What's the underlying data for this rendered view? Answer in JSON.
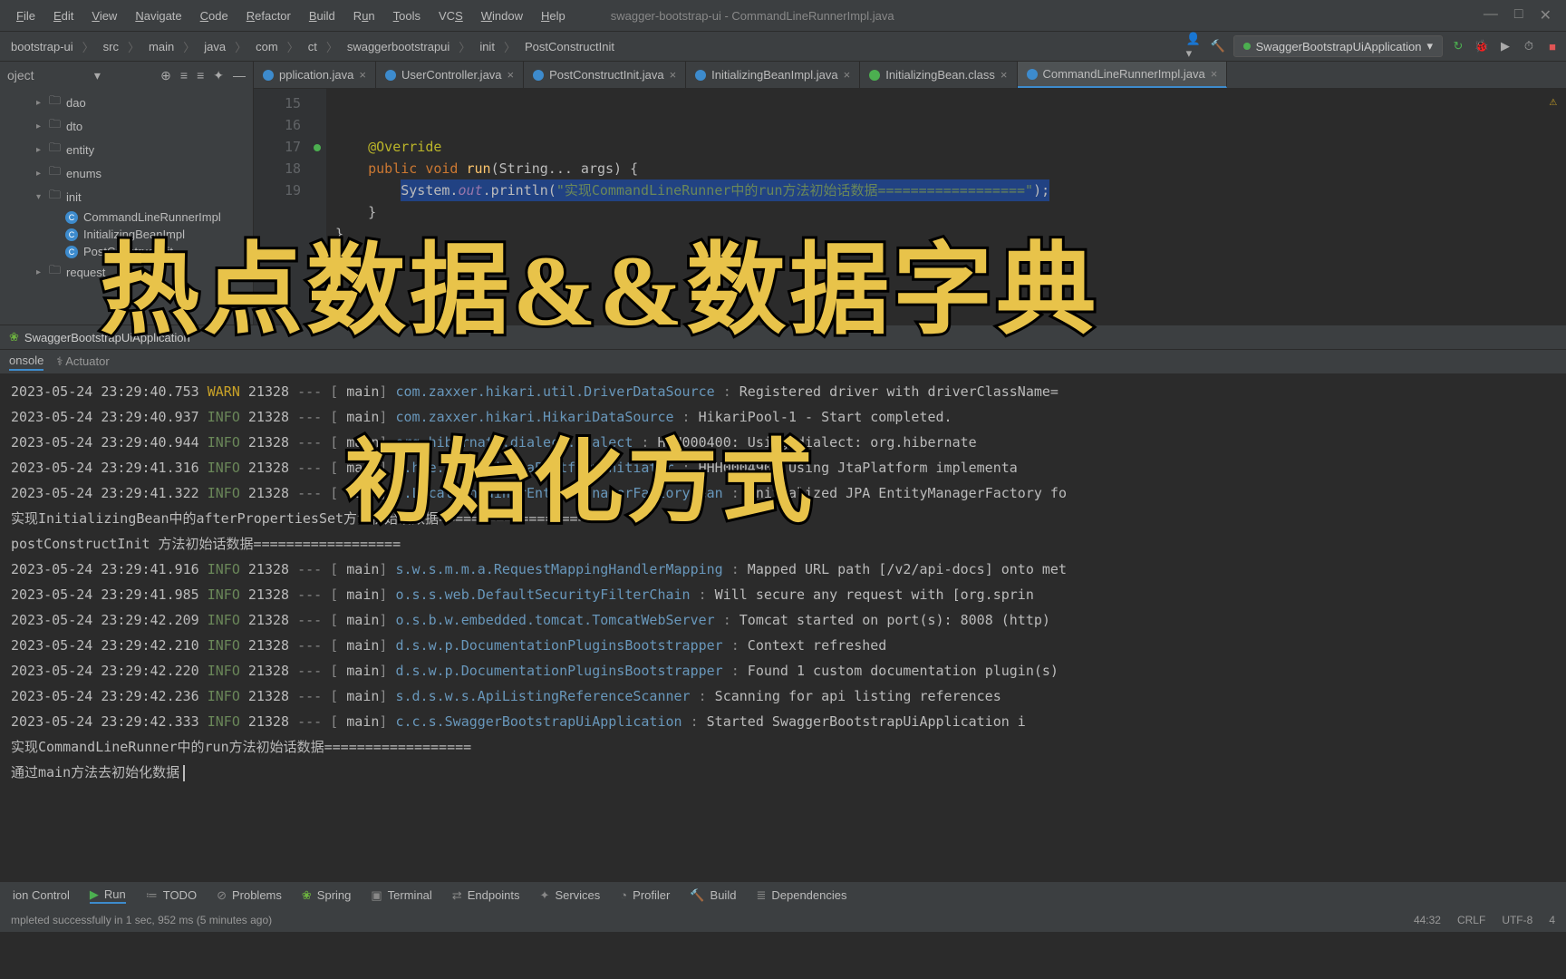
{
  "window_title": "swagger-bootstrap-ui - CommandLineRunnerImpl.java",
  "menu": [
    "File",
    "Edit",
    "View",
    "Navigate",
    "Code",
    "Refactor",
    "Build",
    "Run",
    "Tools",
    "VCS",
    "Window",
    "Help"
  ],
  "breadcrumb": [
    "bootstrap-ui",
    "src",
    "main",
    "java",
    "com",
    "ct",
    "swaggerbootstrapui",
    "init",
    "PostConstructInit"
  ],
  "run_config": "SwaggerBootstrapUiApplication",
  "project_label": "oject",
  "tree": {
    "items": [
      {
        "kind": "folder",
        "name": "dao",
        "indent": 1,
        "expand": "right"
      },
      {
        "kind": "folder",
        "name": "dto",
        "indent": 1,
        "expand": "right"
      },
      {
        "kind": "folder",
        "name": "entity",
        "indent": 1,
        "expand": "right"
      },
      {
        "kind": "folder",
        "name": "enums",
        "indent": 1,
        "expand": "right"
      },
      {
        "kind": "folder",
        "name": "init",
        "indent": 1,
        "expand": "down"
      },
      {
        "kind": "class",
        "name": "CommandLineRunnerImpl",
        "indent": 2
      },
      {
        "kind": "class",
        "name": "InitializingBeanImpl",
        "indent": 2
      },
      {
        "kind": "class",
        "name": "PostConstructInit",
        "indent": 2
      },
      {
        "kind": "folder",
        "name": "request",
        "indent": 1,
        "expand": "right"
      }
    ]
  },
  "swagger_run_label": "SwaggerBootstrapUiApplication",
  "editor_tabs": [
    {
      "label": "pplication.java"
    },
    {
      "label": "UserController.java"
    },
    {
      "label": "PostConstructInit.java"
    },
    {
      "label": "InitializingBeanImpl.java"
    },
    {
      "label": "InitializingBean.class",
      "green": true
    },
    {
      "label": "CommandLineRunnerImpl.java",
      "active": true
    }
  ],
  "code": {
    "gutter": [
      "15",
      "16",
      "17",
      "18",
      "19",
      ""
    ],
    "l16_ann": "@Override",
    "l17_kw1": "public void ",
    "l17_fn": "run",
    "l17_rest": "(String... args) {",
    "l18_pre": "System.",
    "l18_fld": "out",
    "l18_call": ".println(",
    "l18_str": "\"实现CommandLineRunner中的run方法初始话数据==================\"",
    "l18_end": ");",
    "l19": "    }",
    "l20": "}"
  },
  "run_subtabs": {
    "console": "onsole",
    "actuator": "Actuator"
  },
  "logs": [
    {
      "ts": "2023-05-24 23:29:40.753",
      "lvl": "WARN",
      "pid": "21328",
      "thread": "main",
      "logger": "com.zaxxer.hikari.util.DriverDataSource",
      "msg": "Registered driver with driverClassName="
    },
    {
      "ts": "2023-05-24 23:29:40.937",
      "lvl": "INFO",
      "pid": "21328",
      "thread": "main",
      "logger": "com.zaxxer.hikari.HikariDataSource",
      "msg": "HikariPool-1 - Start completed."
    },
    {
      "ts": "2023-05-24 23:29:40.944",
      "lvl": "INFO",
      "pid": "21328",
      "thread": "main",
      "logger": "org.hibernate.dialect.Dialect",
      "msg": "HHH000400: Using dialect: org.hibernate"
    },
    {
      "ts": "2023-05-24 23:29:41.316",
      "lvl": "INFO",
      "pid": "21328",
      "thread": "main",
      "logger": "o.h.e.t.j.p.i.JtaPlatformInitiator",
      "msg": "HHH000490: Using JtaPlatform implementa"
    },
    {
      "ts": "2023-05-24 23:29:41.322",
      "lvl": "INFO",
      "pid": "21328",
      "thread": "main",
      "logger": "j.LocalContainerEntityManagerFactoryBean",
      "msg": "Initialized JPA EntityManagerFactory fo"
    }
  ],
  "plain1": "实现InitializingBean中的afterPropertiesSet方法初始话数据==================",
  "plain2": "postConstructInit 方法初始话数据==================",
  "logs2": [
    {
      "ts": "2023-05-24 23:29:41.916",
      "lvl": "INFO",
      "pid": "21328",
      "thread": "main",
      "logger": "s.w.s.m.m.a.RequestMappingHandlerMapping",
      "msg": "Mapped URL path [/v2/api-docs] onto met"
    },
    {
      "ts": "2023-05-24 23:29:41.985",
      "lvl": "INFO",
      "pid": "21328",
      "thread": "main",
      "logger": "o.s.s.web.DefaultSecurityFilterChain",
      "msg": "Will secure any request with [org.sprin"
    },
    {
      "ts": "2023-05-24 23:29:42.209",
      "lvl": "INFO",
      "pid": "21328",
      "thread": "main",
      "logger": "o.s.b.w.embedded.tomcat.TomcatWebServer",
      "msg": "Tomcat started on port(s): 8008 (http)"
    },
    {
      "ts": "2023-05-24 23:29:42.210",
      "lvl": "INFO",
      "pid": "21328",
      "thread": "main",
      "logger": "d.s.w.p.DocumentationPluginsBootstrapper",
      "msg": "Context refreshed"
    },
    {
      "ts": "2023-05-24 23:29:42.220",
      "lvl": "INFO",
      "pid": "21328",
      "thread": "main",
      "logger": "d.s.w.p.DocumentationPluginsBootstrapper",
      "msg": "Found 1 custom documentation plugin(s)"
    },
    {
      "ts": "2023-05-24 23:29:42.236",
      "lvl": "INFO",
      "pid": "21328",
      "thread": "main",
      "logger": "s.d.s.w.s.ApiListingReferenceScanner",
      "msg": "Scanning for api listing references"
    },
    {
      "ts": "2023-05-24 23:29:42.333",
      "lvl": "INFO",
      "pid": "21328",
      "thread": "main",
      "logger": "c.c.s.SwaggerBootstrapUiApplication",
      "msg": "Started SwaggerBootstrapUiApplication i"
    }
  ],
  "plain3": "实现CommandLineRunner中的run方法初始话数据==================",
  "plain4": "通过main方法去初始化数据",
  "bottom_tabs": {
    "vc": "ion Control",
    "run": "Run",
    "todo": "TODO",
    "problems": "Problems",
    "spring": "Spring",
    "terminal": "Terminal",
    "endpoints": "Endpoints",
    "services": "Services",
    "profiler": "Profiler",
    "build": "Build",
    "deps": "Dependencies"
  },
  "status_msg": "mpleted successfully in 1 sec, 952 ms (5 minutes ago)",
  "status_right": {
    "pos": "44:32",
    "eol": "CRLF",
    "enc": "UTF-8",
    "indent": "4"
  },
  "overlay": {
    "l1": "热点数据&&数据字典",
    "l2": "初始化方式"
  }
}
